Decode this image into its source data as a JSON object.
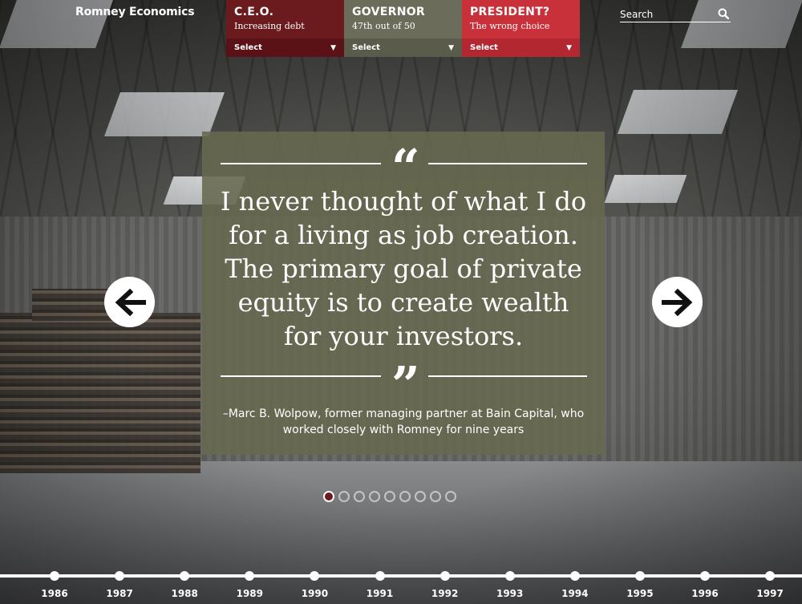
{
  "brand": "Romney Economics",
  "nav": [
    {
      "title": "C.E.O.",
      "subtitle": "Increasing debt",
      "select": "Select"
    },
    {
      "title": "GOVERNOR",
      "subtitle": "47th out of 50",
      "select": "Select"
    },
    {
      "title": "PRESIDENT?",
      "subtitle": "The wrong choice",
      "select": "Select"
    }
  ],
  "search": {
    "placeholder": "Search"
  },
  "quote": {
    "text": "I never thought of what I do for a living as job creation. The primary goal of private equity is to create wealth for your investors.",
    "attribution": "–Marc B. Wolpow, former managing partner at Bain Capital, who worked closely with Romney for nine years"
  },
  "pager": {
    "total": 9,
    "active": 1
  },
  "timeline": {
    "years": [
      "1986",
      "1987",
      "1988",
      "1989",
      "1990",
      "1991",
      "1992",
      "1993",
      "1994",
      "1995",
      "1996",
      "1997"
    ]
  },
  "colors": {
    "ceo": "#6b1a1e",
    "governor": "#6c6c5a",
    "president": "#c8313a",
    "quote_panel": "#66694f"
  },
  "icons": {
    "search": "search-icon",
    "prev": "arrow-left-icon",
    "next": "arrow-right-icon"
  }
}
